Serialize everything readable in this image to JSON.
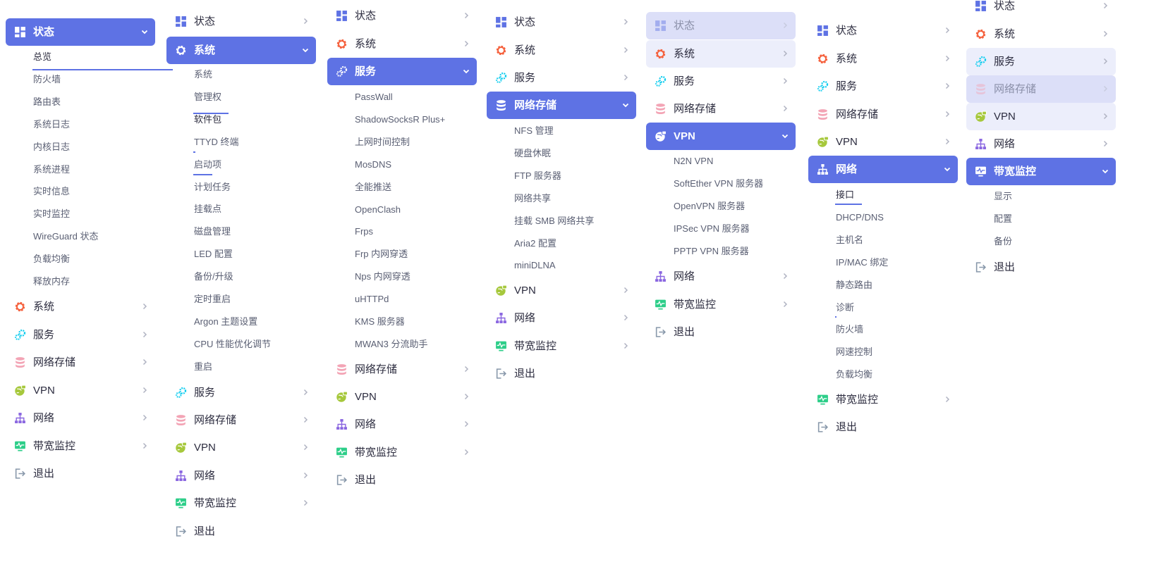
{
  "colors": {
    "accent": "#5e72e4",
    "status_icon": "#5e72e4",
    "system_icon": "#f5603c",
    "service_icon": "#11cdef",
    "storage_icon": "#f3a4b5",
    "vpn_icon": "#a6c83c",
    "network_icon": "#8965e0",
    "bandwidth_icon": "#2dce89",
    "logout_icon": "#8898aa"
  },
  "menu_labels": {
    "status": "状态",
    "system": "系统",
    "services": "服务",
    "storage": "网络存储",
    "vpn": "VPN",
    "network": "网络",
    "bandwidth": "带宽监控",
    "logout": "退出"
  },
  "icons": {
    "status": "dashboard-grid-icon",
    "system": "gear-icon",
    "services": "gears-icon",
    "storage": "database-icon",
    "vpn": "globe-lock-icon",
    "network": "sitemap-icon",
    "bandwidth": "monitor-pulse-icon",
    "logout": "sign-out-icon"
  },
  "submenus": {
    "status": [
      "总览",
      "防火墙",
      "路由表",
      "系统日志",
      "内核日志",
      "系统进程",
      "实时信息",
      "实时监控",
      "WireGuard 状态",
      "负载均衡",
      "释放内存"
    ],
    "system": [
      "系统",
      "管理权",
      "软件包",
      "TTYD 终端",
      "启动项",
      "计划任务",
      "挂载点",
      "磁盘管理",
      "LED 配置",
      "备份/升级",
      "定时重启",
      "Argon 主题设置",
      "CPU 性能优化调节",
      "重启"
    ],
    "services": [
      "PassWall",
      "ShadowSocksR Plus+",
      "上网时间控制",
      "MosDNS",
      "全能推送",
      "OpenClash",
      "Frps",
      "Frp 内网穿透",
      "Nps 内网穿透",
      "uHTTPd",
      "KMS 服务器",
      "MWAN3 分流助手"
    ],
    "storage": [
      "NFS 管理",
      "硬盘休眠",
      "FTP 服务器",
      "网络共享",
      "挂载 SMB 网络共享",
      "Aria2 配置",
      "miniDLNA"
    ],
    "vpn": [
      "N2N VPN",
      "SoftEther VPN 服务器",
      "OpenVPN 服务器",
      "IPSec VPN 服务器",
      "PPTP VPN 服务器"
    ],
    "network": [
      "接口",
      "DHCP/DNS",
      "主机名",
      "IP/MAC 绑定",
      "静态路由",
      "诊断",
      "防火墙",
      "网速控制",
      "负载均衡"
    ],
    "bandwidth": [
      "显示",
      "配置",
      "备份"
    ]
  }
}
